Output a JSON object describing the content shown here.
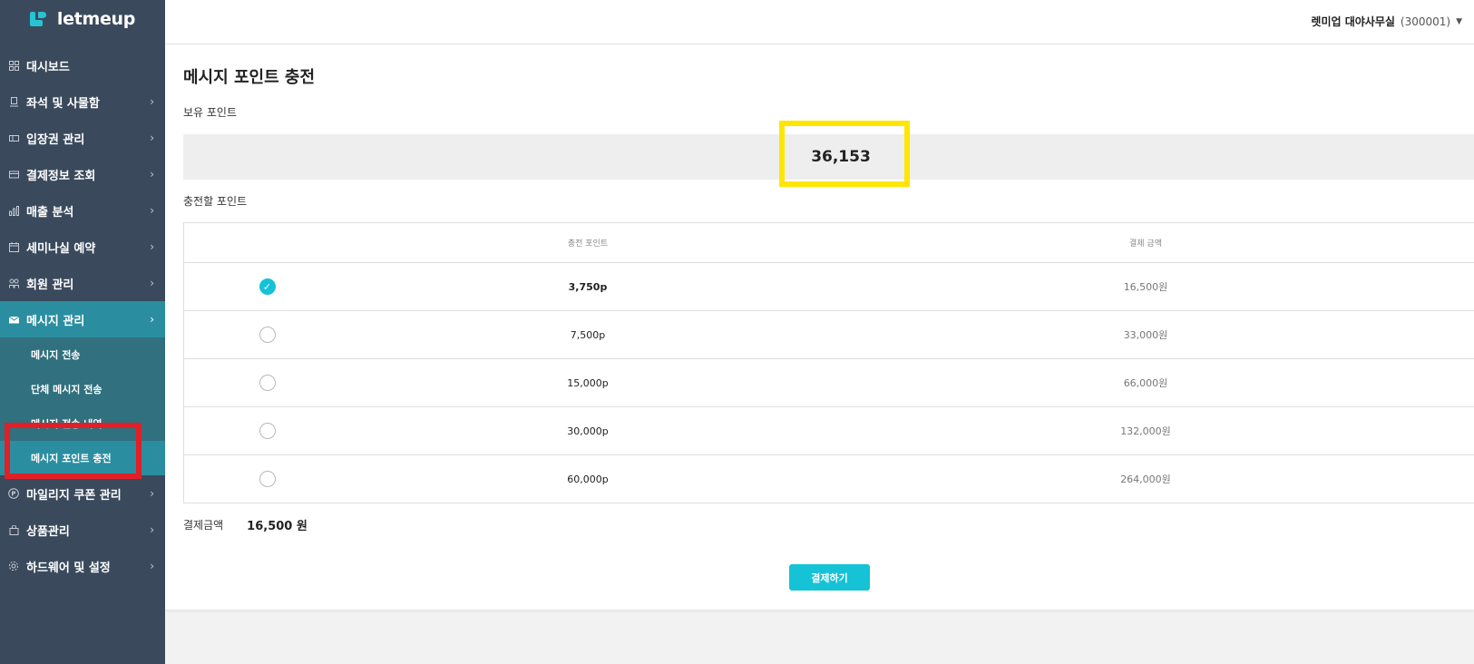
{
  "brand": {
    "name": "letmeup",
    "accent": "#15c2d6"
  },
  "sidebar": {
    "items": [
      {
        "label": "대시보드",
        "icon": "grid-icon",
        "has_chevron": false
      },
      {
        "label": "좌석 및 사물함",
        "icon": "seat-icon",
        "has_chevron": true
      },
      {
        "label": "입장권 관리",
        "icon": "ticket-icon",
        "has_chevron": true
      },
      {
        "label": "결제정보 조회",
        "icon": "card-icon",
        "has_chevron": true
      },
      {
        "label": "매출 분석",
        "icon": "bar-chart-icon",
        "has_chevron": true
      },
      {
        "label": "세미나실 예약",
        "icon": "calendar-icon",
        "has_chevron": true
      },
      {
        "label": "회원 관리",
        "icon": "users-icon",
        "has_chevron": true
      },
      {
        "label": "메시지 관리",
        "icon": "mail-icon",
        "has_chevron": true,
        "active": true
      },
      {
        "label": "마일리지 쿠폰 관리",
        "icon": "coupon-icon",
        "has_chevron": true
      },
      {
        "label": "상품관리",
        "icon": "bag-icon",
        "has_chevron": true
      },
      {
        "label": "하드웨어 및 설정",
        "icon": "gear-icon",
        "has_chevron": true
      }
    ],
    "submenu": [
      {
        "label": "메시지 전송"
      },
      {
        "label": "단체 메시지 전송"
      },
      {
        "label": "메시지 전송 내역"
      },
      {
        "label": "메시지 포인트 충전",
        "active": true
      }
    ]
  },
  "header": {
    "user_name": "렛미업 대야사무실",
    "user_code": "(300001)"
  },
  "main": {
    "title": "메시지 포인트 충전",
    "held_points_label": "보유 포인트",
    "held_points_value": "36,153",
    "charge_label": "충전할 포인트",
    "table": {
      "headers": [
        "충전 포인트",
        "결제 금액"
      ],
      "rows": [
        {
          "points": "3,750p",
          "price": "16,500원",
          "selected": true
        },
        {
          "points": "7,500p",
          "price": "33,000원",
          "selected": false
        },
        {
          "points": "15,000p",
          "price": "66,000원",
          "selected": false
        },
        {
          "points": "30,000p",
          "price": "132,000원",
          "selected": false
        },
        {
          "points": "60,000p",
          "price": "264,000원",
          "selected": false
        }
      ]
    },
    "total_label": "결제금액",
    "total_value": "16,500 원",
    "pay_button": "결제하기"
  }
}
